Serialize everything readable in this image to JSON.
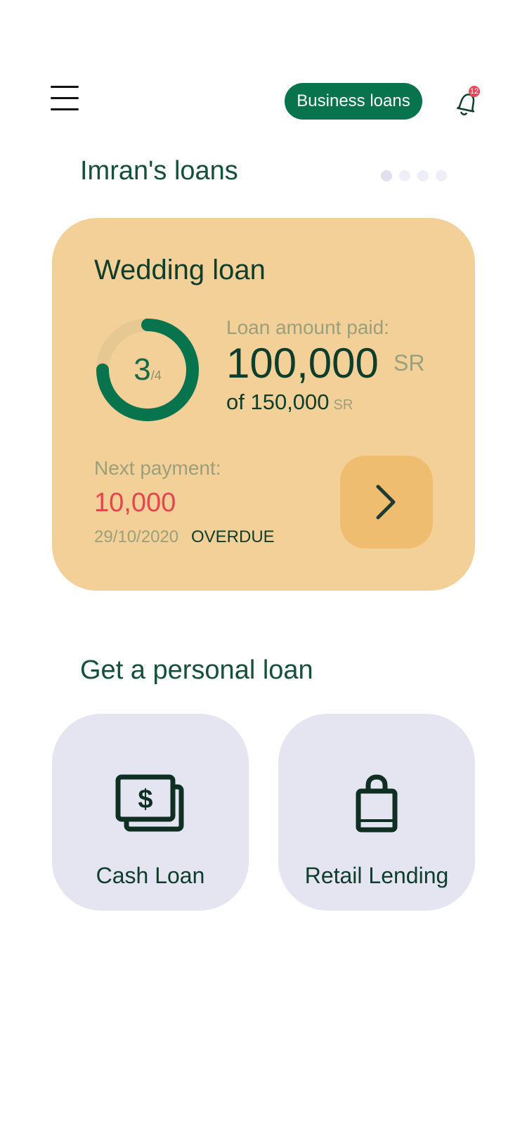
{
  "header": {
    "menu_icon": "hamburger-icon",
    "business_loans_label": "Business loans",
    "notification_icon": "bell-icon",
    "notification_count": "12"
  },
  "loans_section": {
    "title": "Imran's loans",
    "carousel_pages": 4,
    "active_page": 1
  },
  "loan_card": {
    "title": "Wedding loan",
    "installments_paid": "3",
    "installments_total": "/4",
    "progress_fraction": 0.75,
    "paid_label": "Loan amount paid:",
    "paid_amount": "100,000",
    "paid_unit": "SR",
    "total_prefix": "of 150,000",
    "total_unit": "SR",
    "next_payment_label": "Next payment:",
    "next_payment_amount": "10,000",
    "next_payment_date": "29/10/2020",
    "status": "OVERDUE",
    "arrow_icon": "chevron-right-icon"
  },
  "personal_section": {
    "title": "Get a personal loan",
    "options": [
      {
        "label": "Cash Loan",
        "icon": "cash-icon"
      },
      {
        "label": "Retail Lending",
        "icon": "shopping-bag-icon"
      }
    ]
  },
  "colors": {
    "brand_green": "#08744d",
    "card_background": "#f3d097",
    "card_button": "#efbd6f",
    "overdue_red": "#e9434f",
    "tile_background": "#e5e5f1",
    "badge_red": "#ee4658"
  }
}
